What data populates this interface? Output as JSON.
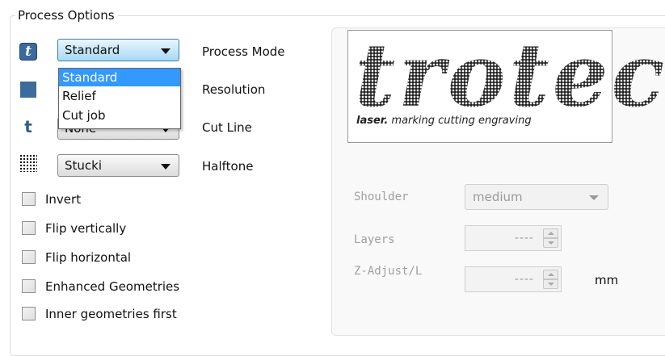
{
  "group_title": "Process Options",
  "rows": [
    {
      "icon": "process-mode-icon",
      "value": "Standard",
      "label": "Process Mode"
    },
    {
      "icon": "resolution-square-icon",
      "value": "",
      "label": "Resolution"
    },
    {
      "icon": "cut-line-t-icon",
      "value": "None",
      "label": "Cut Line"
    },
    {
      "icon": "halftone-dither-icon",
      "value": "Stucki",
      "label": "Halftone"
    }
  ],
  "dropdown_options": [
    "Standard",
    "Relief",
    "Cut job"
  ],
  "dropdown_selected": "Standard",
  "checkboxes": [
    {
      "label": "Invert",
      "checked": false
    },
    {
      "label": "Flip vertically",
      "checked": false
    },
    {
      "label": "Flip horizontal",
      "checked": false
    },
    {
      "label": "Enhanced Geometries",
      "checked": false
    },
    {
      "label": "Inner geometries first",
      "checked": false
    }
  ],
  "logo": {
    "word": "trotec",
    "tagline_bold": "laser.",
    "tagline_rest": " marking cutting engraving"
  },
  "right_fields": {
    "shoulder_label": "Shoulder",
    "shoulder_value": "medium",
    "layers_label": "Layers",
    "layers_value": "----",
    "zadjust_label": "Z-Adjust/L",
    "zadjust_value": "----",
    "zadjust_unit": "mm"
  },
  "colors": {
    "selection": "#3399ff",
    "icon_blue": "#3b6aa0",
    "disabled_text": "#9a9a9a"
  }
}
